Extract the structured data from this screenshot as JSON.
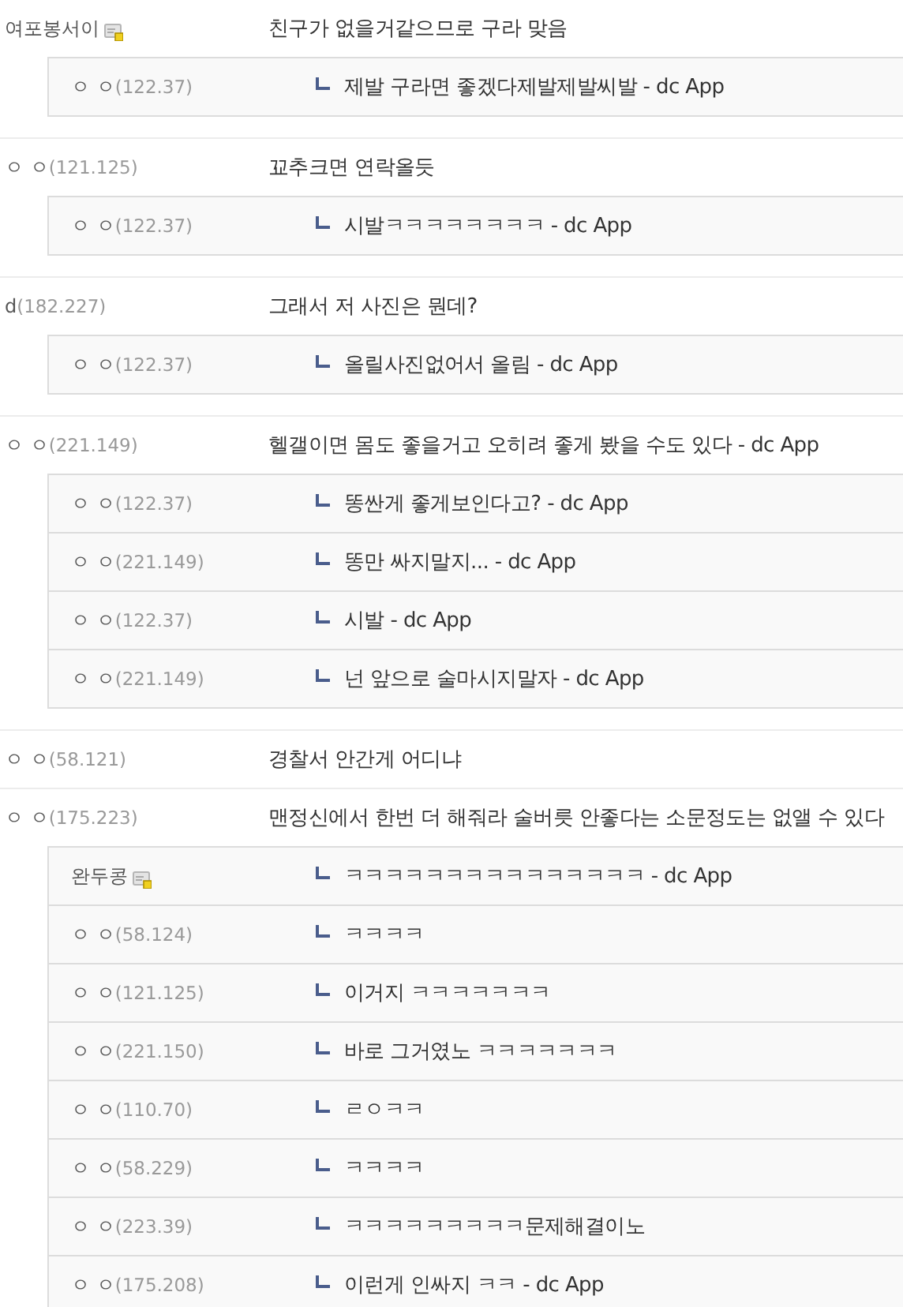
{
  "threads": [
    {
      "author": {
        "name": "여포봉서이",
        "member_icon": true
      },
      "text": "친구가 없을거같으므로 구라 맞음",
      "replies": [
        {
          "author": {
            "name": "ㅇ ㅇ",
            "ip": "(122.37)",
            "member_icon": false
          },
          "text": "제발 구라면 좋겠다제발제발씨발 - dc App"
        }
      ]
    },
    {
      "author": {
        "name": "ㅇ ㅇ",
        "ip": "(121.125)",
        "member_icon": false
      },
      "text": "꾜추크면 연락올듯",
      "replies": [
        {
          "author": {
            "name": "ㅇ ㅇ",
            "ip": "(122.37)",
            "member_icon": false
          },
          "text": "시발ㅋㅋㅋㅋㅋㅋㅋㅋ - dc App"
        }
      ]
    },
    {
      "author": {
        "name": "d",
        "ip": "(182.227)",
        "member_icon": false
      },
      "text": "그래서 저 사진은 뭔데?",
      "replies": [
        {
          "author": {
            "name": "ㅇ ㅇ",
            "ip": "(122.37)",
            "member_icon": false
          },
          "text": "올릴사진없어서 올림 - dc App"
        }
      ]
    },
    {
      "author": {
        "name": "ㅇ ㅇ",
        "ip": "(221.149)",
        "member_icon": false
      },
      "text": "헬갤이면 몸도 좋을거고 오히려 좋게 봤을 수도 있다 - dc App",
      "replies": [
        {
          "author": {
            "name": "ㅇ ㅇ",
            "ip": "(122.37)",
            "member_icon": false
          },
          "text": "똥싼게 좋게보인다고? - dc App"
        },
        {
          "author": {
            "name": "ㅇ ㅇ",
            "ip": "(221.149)",
            "member_icon": false
          },
          "text": "똥만 싸지말지... - dc App"
        },
        {
          "author": {
            "name": "ㅇ ㅇ",
            "ip": "(122.37)",
            "member_icon": false
          },
          "text": "시발 - dc App"
        },
        {
          "author": {
            "name": "ㅇ ㅇ",
            "ip": "(221.149)",
            "member_icon": false
          },
          "text": "넌 앞으로 술마시지말자 - dc App"
        }
      ]
    },
    {
      "author": {
        "name": "ㅇ ㅇ",
        "ip": "(58.121)",
        "member_icon": false
      },
      "text": "경찰서 안간게 어디냐"
    },
    {
      "author": {
        "name": "ㅇ ㅇ",
        "ip": "(175.223)",
        "member_icon": false
      },
      "text": "맨정신에서 한번 더 해줘라 술버릇 안좋다는 소문정도는 없앨 수 있다",
      "replies": [
        {
          "author": {
            "name": "완두콩",
            "member_icon": true
          },
          "text": "ㅋㅋㅋㅋㅋㅋㅋㅋㅋㅋㅋㅋㅋㅋㅋ - dc App"
        },
        {
          "author": {
            "name": "ㅇ ㅇ",
            "ip": "(58.124)",
            "member_icon": false
          },
          "text": "ㅋㅋㅋㅋ"
        },
        {
          "author": {
            "name": "ㅇ ㅇ",
            "ip": "(121.125)",
            "member_icon": false
          },
          "text": "이거지 ㅋㅋㅋㅋㅋㅋㅋ"
        },
        {
          "author": {
            "name": "ㅇ ㅇ",
            "ip": "(221.150)",
            "member_icon": false
          },
          "text": "바로 그거였노 ㅋㅋㅋㅋㅋㅋㅋ"
        },
        {
          "author": {
            "name": "ㅇ ㅇ",
            "ip": "(110.70)",
            "member_icon": false
          },
          "text": "ㄹㅇㅋㅋ"
        },
        {
          "author": {
            "name": "ㅇ ㅇ",
            "ip": "(58.229)",
            "member_icon": false
          },
          "text": "ㅋㅋㅋㅋ"
        },
        {
          "author": {
            "name": "ㅇ ㅇ",
            "ip": "(223.39)",
            "member_icon": false
          },
          "text": "ㅋㅋㅋㅋㅋㅋㅋㅋㅋ문제해결이노"
        },
        {
          "author": {
            "name": "ㅇ ㅇ",
            "ip": "(175.208)",
            "member_icon": false
          },
          "text": "이런게 인싸지 ㅋㅋ - dc App"
        }
      ]
    }
  ]
}
